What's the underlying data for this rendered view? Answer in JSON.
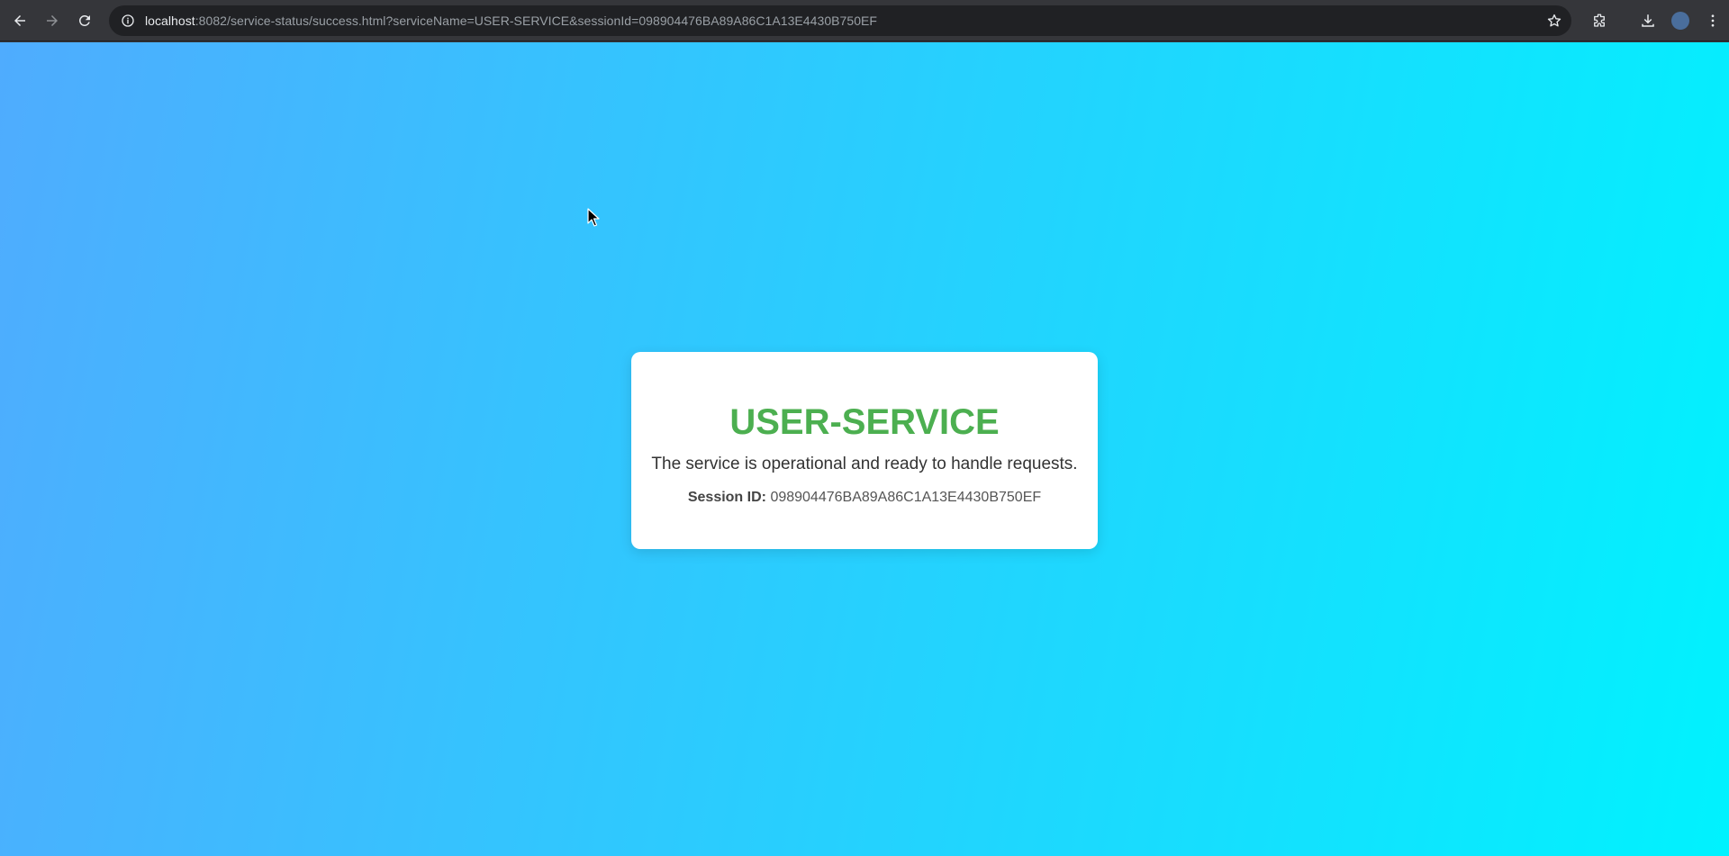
{
  "browser": {
    "url_host": "localhost",
    "url_rest": ":8082/service-status/success.html?serviceName=USER-SERVICE&sessionId=098904476BA89A86C1A13E4430B750EF",
    "icons": [
      "back-icon",
      "forward-icon",
      "reload-icon",
      "site-info-icon",
      "bookmark-star-icon",
      "extensions-icon",
      "download-icon",
      "profile-avatar",
      "more-menu-icon"
    ]
  },
  "page": {
    "service_name": "USER-SERVICE",
    "message": "The service is operational and ready to handle requests.",
    "session_label": "Session ID:",
    "session_id": "098904476BA89A86C1A13E4430B750EF"
  },
  "colors": {
    "gradient_start": "#4facfe",
    "gradient_end": "#00f2fe",
    "title_green": "#4caf50",
    "card_bg": "#ffffff"
  }
}
